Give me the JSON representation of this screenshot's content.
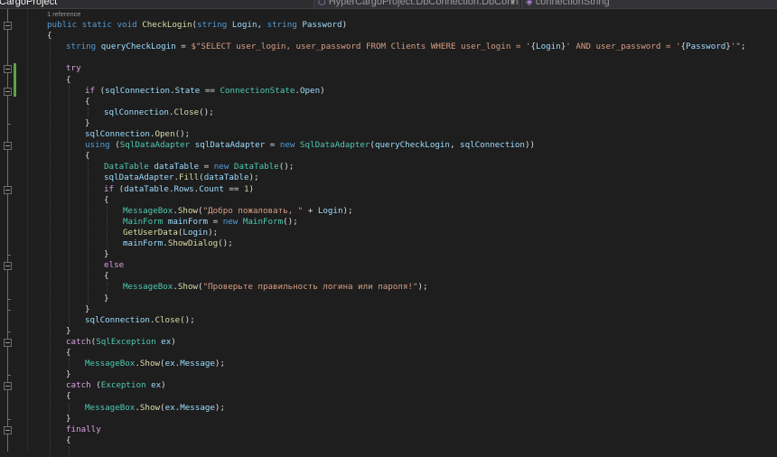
{
  "navbar": {
    "project_combo": "CargoProject",
    "type_combo": "HyperCargoProject.DbConnection.DbConnection",
    "member_combo": "connectionString"
  },
  "code_lens": "1 reference",
  "code_lines": [
    {
      "indent": 1,
      "tokens": [
        [
          "k",
          "public"
        ],
        [
          "p",
          " "
        ],
        [
          "k",
          "static"
        ],
        [
          "p",
          " "
        ],
        [
          "k",
          "void"
        ],
        [
          "p",
          " "
        ],
        [
          "m",
          "CheckLogin"
        ],
        [
          "p",
          "("
        ],
        [
          "k",
          "string"
        ],
        [
          "p",
          " "
        ],
        [
          "v",
          "Login"
        ],
        [
          "p",
          ", "
        ],
        [
          "k",
          "string"
        ],
        [
          "p",
          " "
        ],
        [
          "v",
          "Password"
        ],
        [
          "p",
          ")"
        ]
      ]
    },
    {
      "indent": 1,
      "tokens": [
        [
          "p",
          "{"
        ]
      ]
    },
    {
      "indent": 2,
      "tokens": [
        [
          "k",
          "string"
        ],
        [
          "p",
          " "
        ],
        [
          "v",
          "queryCheckLogin"
        ],
        [
          "p",
          " = "
        ],
        [
          "s",
          "$\"SELECT user_login, user_password FROM Clients WHERE user_login = '"
        ],
        [
          "p",
          "{"
        ],
        [
          "v",
          "Login"
        ],
        [
          "p",
          "}"
        ],
        [
          "s",
          "' AND user_password = '"
        ],
        [
          "p",
          "{"
        ],
        [
          "v",
          "Password"
        ],
        [
          "p",
          "}"
        ],
        [
          "s",
          "'\""
        ],
        [
          "p",
          ";"
        ]
      ]
    },
    {
      "indent": 2,
      "tokens": []
    },
    {
      "indent": 2,
      "tokens": [
        [
          "kc",
          "try"
        ]
      ]
    },
    {
      "indent": 2,
      "tokens": [
        [
          "p",
          "{"
        ]
      ]
    },
    {
      "indent": 3,
      "tokens": [
        [
          "kc",
          "if"
        ],
        [
          "p",
          " ("
        ],
        [
          "v",
          "sqlConnection"
        ],
        [
          "p",
          "."
        ],
        [
          "v",
          "State"
        ],
        [
          "p",
          " == "
        ],
        [
          "t",
          "ConnectionState"
        ],
        [
          "p",
          "."
        ],
        [
          "v",
          "Open"
        ],
        [
          "p",
          ")"
        ]
      ]
    },
    {
      "indent": 3,
      "tokens": [
        [
          "p",
          "{"
        ]
      ]
    },
    {
      "indent": 4,
      "tokens": [
        [
          "v",
          "sqlConnection"
        ],
        [
          "p",
          "."
        ],
        [
          "m",
          "Close"
        ],
        [
          "p",
          "();"
        ]
      ]
    },
    {
      "indent": 3,
      "tokens": [
        [
          "p",
          "}"
        ]
      ]
    },
    {
      "indent": 3,
      "tokens": [
        [
          "v",
          "sqlConnection"
        ],
        [
          "p",
          "."
        ],
        [
          "m",
          "Open"
        ],
        [
          "p",
          "();"
        ]
      ]
    },
    {
      "indent": 3,
      "tokens": [
        [
          "k",
          "using"
        ],
        [
          "p",
          " ("
        ],
        [
          "t",
          "SqlDataAdapter"
        ],
        [
          "p",
          " "
        ],
        [
          "v",
          "sqlDataAdapter"
        ],
        [
          "p",
          " = "
        ],
        [
          "k",
          "new"
        ],
        [
          "p",
          " "
        ],
        [
          "t",
          "SqlDataAdapter"
        ],
        [
          "p",
          "("
        ],
        [
          "v",
          "queryCheckLogin"
        ],
        [
          "p",
          ", "
        ],
        [
          "v",
          "sqlConnection"
        ],
        [
          "p",
          "))"
        ]
      ]
    },
    {
      "indent": 3,
      "tokens": [
        [
          "p",
          "{"
        ]
      ]
    },
    {
      "indent": 4,
      "tokens": [
        [
          "t",
          "DataTable"
        ],
        [
          "p",
          " "
        ],
        [
          "v",
          "dataTable"
        ],
        [
          "p",
          " = "
        ],
        [
          "k",
          "new"
        ],
        [
          "p",
          " "
        ],
        [
          "t",
          "DataTable"
        ],
        [
          "p",
          "();"
        ]
      ]
    },
    {
      "indent": 4,
      "tokens": [
        [
          "v",
          "sqlDataAdapter"
        ],
        [
          "p",
          "."
        ],
        [
          "m",
          "Fill"
        ],
        [
          "p",
          "("
        ],
        [
          "v",
          "dataTable"
        ],
        [
          "p",
          ");"
        ]
      ]
    },
    {
      "indent": 4,
      "tokens": [
        [
          "kc",
          "if"
        ],
        [
          "p",
          " ("
        ],
        [
          "v",
          "dataTable"
        ],
        [
          "p",
          "."
        ],
        [
          "v",
          "Rows"
        ],
        [
          "p",
          "."
        ],
        [
          "v",
          "Count"
        ],
        [
          "p",
          " == "
        ],
        [
          "n",
          "1"
        ],
        [
          "p",
          ")"
        ]
      ]
    },
    {
      "indent": 4,
      "tokens": [
        [
          "p",
          "{"
        ]
      ]
    },
    {
      "indent": 5,
      "tokens": [
        [
          "t",
          "MessageBox"
        ],
        [
          "p",
          "."
        ],
        [
          "m",
          "Show"
        ],
        [
          "p",
          "("
        ],
        [
          "s",
          "\"Добро пожаловать, \""
        ],
        [
          "p",
          " + "
        ],
        [
          "v",
          "Login"
        ],
        [
          "p",
          ");"
        ]
      ]
    },
    {
      "indent": 5,
      "tokens": [
        [
          "t",
          "MainForm"
        ],
        [
          "p",
          " "
        ],
        [
          "v",
          "mainForm"
        ],
        [
          "p",
          " = "
        ],
        [
          "k",
          "new"
        ],
        [
          "p",
          " "
        ],
        [
          "t",
          "MainForm"
        ],
        [
          "p",
          "();"
        ]
      ]
    },
    {
      "indent": 5,
      "tokens": [
        [
          "m",
          "GetUserData"
        ],
        [
          "p",
          "("
        ],
        [
          "v",
          "Login"
        ],
        [
          "p",
          ");"
        ]
      ]
    },
    {
      "indent": 5,
      "tokens": [
        [
          "v",
          "mainForm"
        ],
        [
          "p",
          "."
        ],
        [
          "m",
          "ShowDialog"
        ],
        [
          "p",
          "();"
        ]
      ]
    },
    {
      "indent": 4,
      "tokens": [
        [
          "p",
          "}"
        ]
      ]
    },
    {
      "indent": 4,
      "tokens": [
        [
          "kc",
          "else"
        ]
      ]
    },
    {
      "indent": 4,
      "tokens": [
        [
          "p",
          "{"
        ]
      ]
    },
    {
      "indent": 5,
      "tokens": [
        [
          "t",
          "MessageBox"
        ],
        [
          "p",
          "."
        ],
        [
          "m",
          "Show"
        ],
        [
          "p",
          "("
        ],
        [
          "s",
          "\"Проверьте правильность логина или пароля!\""
        ],
        [
          "p",
          ");"
        ]
      ]
    },
    {
      "indent": 4,
      "tokens": [
        [
          "p",
          "}"
        ]
      ]
    },
    {
      "indent": 3,
      "tokens": [
        [
          "p",
          "}"
        ]
      ]
    },
    {
      "indent": 3,
      "tokens": [
        [
          "v",
          "sqlConnection"
        ],
        [
          "p",
          "."
        ],
        [
          "m",
          "Close"
        ],
        [
          "p",
          "();"
        ]
      ]
    },
    {
      "indent": 2,
      "tokens": [
        [
          "p",
          "}"
        ]
      ]
    },
    {
      "indent": 2,
      "tokens": [
        [
          "kc",
          "catch"
        ],
        [
          "p",
          "("
        ],
        [
          "t",
          "SqlException"
        ],
        [
          "p",
          " "
        ],
        [
          "v",
          "ex"
        ],
        [
          "p",
          ")"
        ]
      ]
    },
    {
      "indent": 2,
      "tokens": [
        [
          "p",
          "{"
        ]
      ]
    },
    {
      "indent": 3,
      "tokens": [
        [
          "t",
          "MessageBox"
        ],
        [
          "p",
          "."
        ],
        [
          "m",
          "Show"
        ],
        [
          "p",
          "("
        ],
        [
          "v",
          "ex"
        ],
        [
          "p",
          "."
        ],
        [
          "v",
          "Message"
        ],
        [
          "p",
          ");"
        ]
      ]
    },
    {
      "indent": 2,
      "tokens": [
        [
          "p",
          "}"
        ]
      ]
    },
    {
      "indent": 2,
      "tokens": [
        [
          "kc",
          "catch"
        ],
        [
          "p",
          " ("
        ],
        [
          "t",
          "Exception"
        ],
        [
          "p",
          " "
        ],
        [
          "v",
          "ex"
        ],
        [
          "p",
          ")"
        ]
      ]
    },
    {
      "indent": 2,
      "tokens": [
        [
          "p",
          "{"
        ]
      ]
    },
    {
      "indent": 3,
      "tokens": [
        [
          "t",
          "MessageBox"
        ],
        [
          "p",
          "."
        ],
        [
          "m",
          "Show"
        ],
        [
          "p",
          "("
        ],
        [
          "v",
          "ex"
        ],
        [
          "p",
          "."
        ],
        [
          "v",
          "Message"
        ],
        [
          "p",
          ");"
        ]
      ]
    },
    {
      "indent": 2,
      "tokens": [
        [
          "p",
          "}"
        ]
      ]
    },
    {
      "indent": 2,
      "tokens": [
        [
          "kc",
          "finally"
        ]
      ]
    },
    {
      "indent": 2,
      "tokens": [
        [
          "p",
          "{"
        ]
      ]
    }
  ],
  "colors": {
    "background": "#1e1e1e",
    "keyword": "#569cd6",
    "control_keyword": "#d8a0df",
    "type": "#4ec9b0",
    "method": "#dcdcaa",
    "string": "#d69d85",
    "variable": "#9cdcfe",
    "number": "#b5cea8",
    "change_bar": "#57a64a"
  }
}
